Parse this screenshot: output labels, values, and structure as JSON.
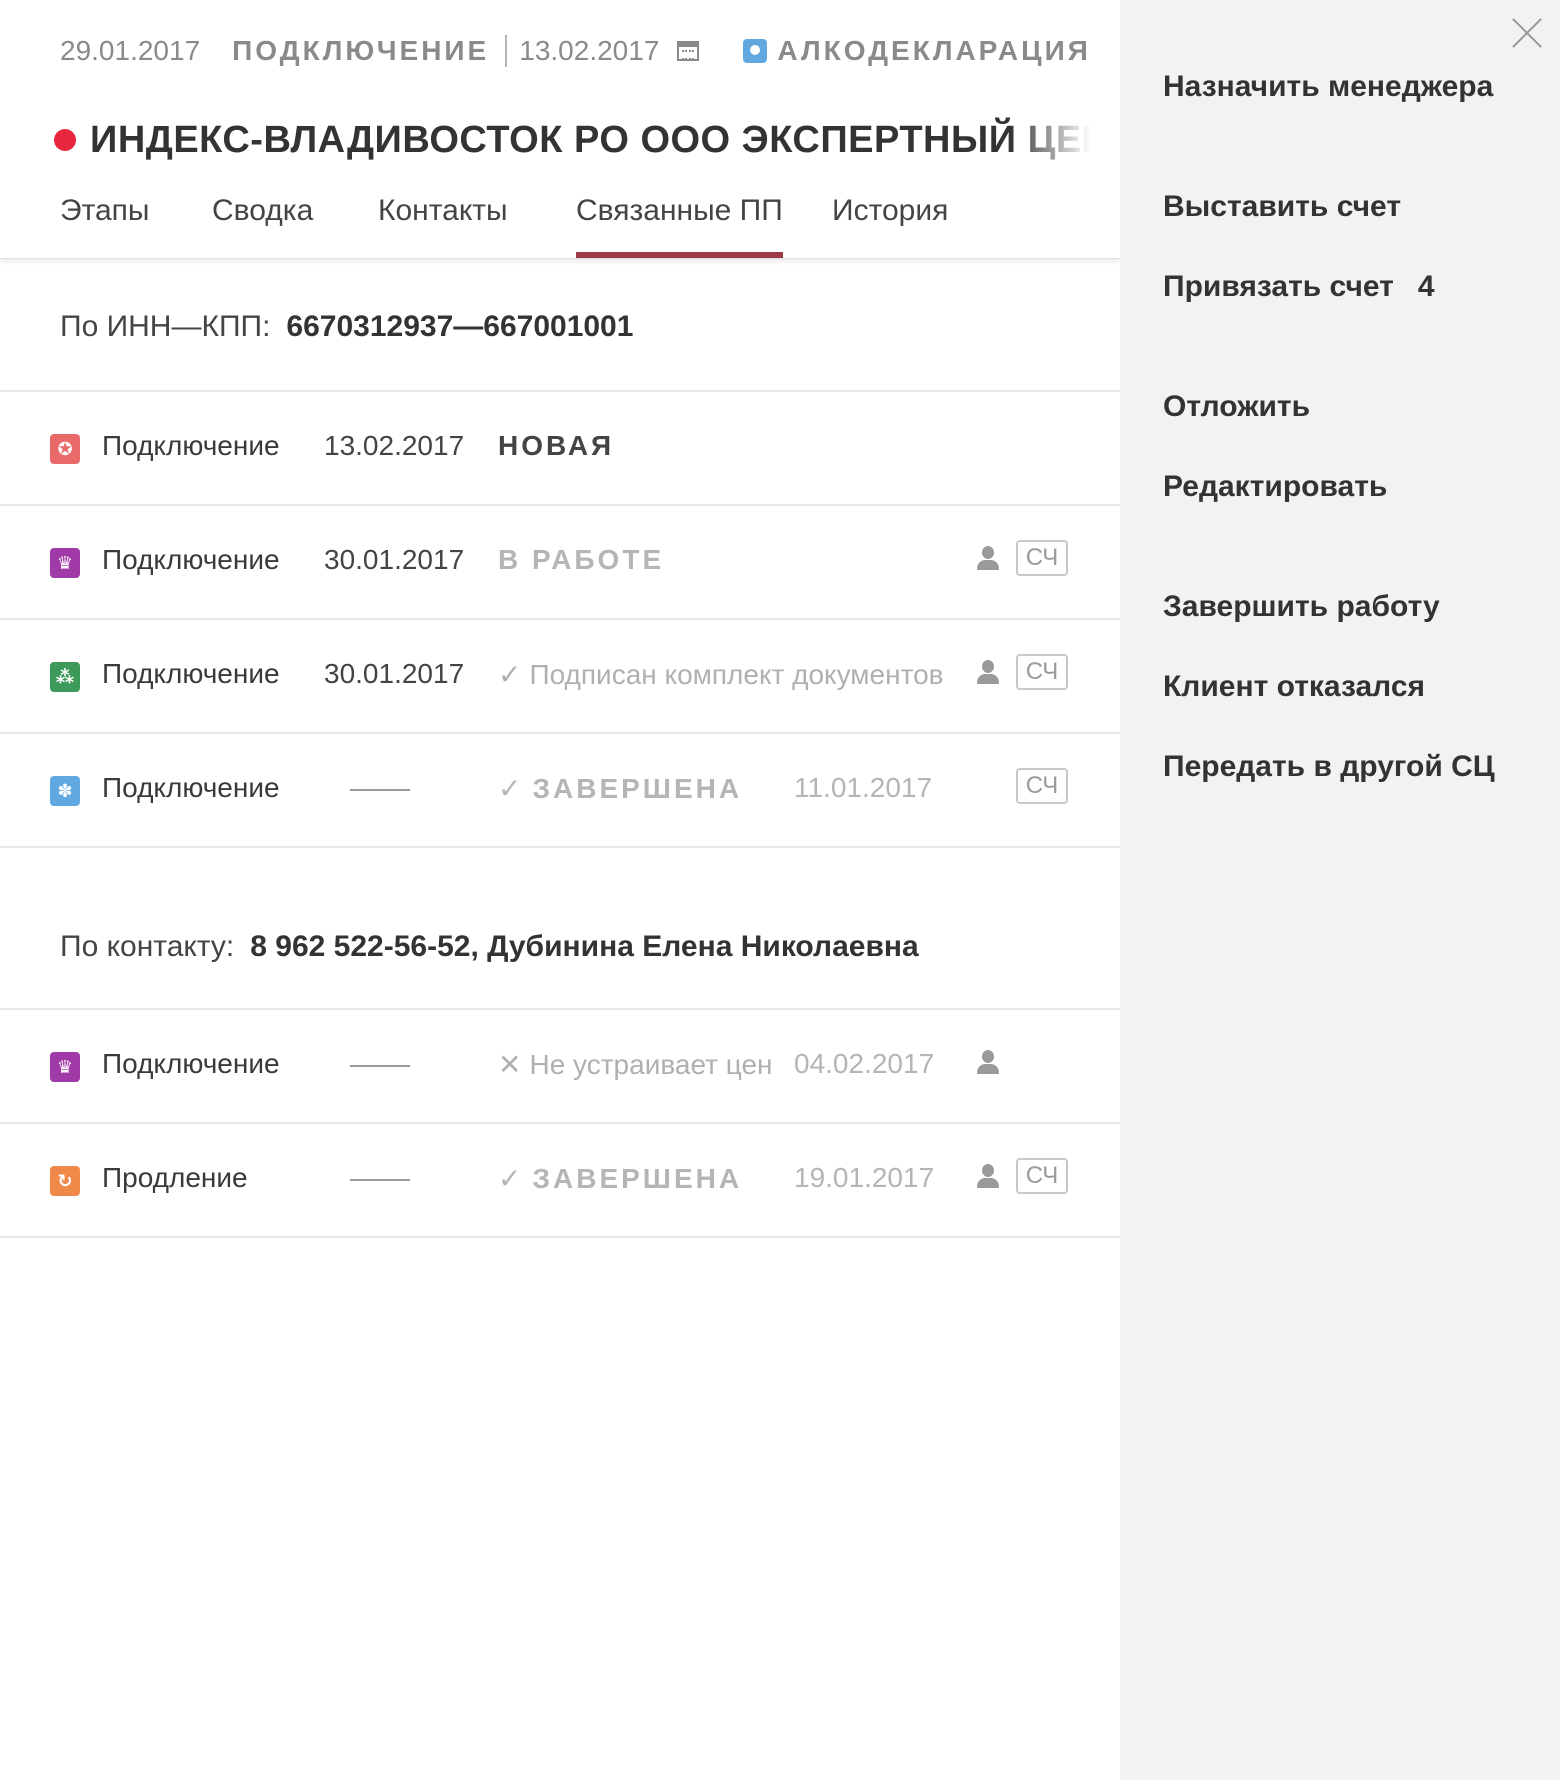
{
  "header": {
    "created_date": "29.01.2017",
    "type": "ПОДКЛЮЧЕНИЕ",
    "planned_date": "13.02.2017",
    "product": "АЛКОДЕКЛАРАЦИЯ",
    "title": "ИНДЕКС-ВЛАДИВОСТОК РО ООО ЭКСПЕРТНЫЙ ЦЕНТР ИН"
  },
  "tabs": [
    {
      "label": "Этапы",
      "active": false
    },
    {
      "label": "Сводка",
      "active": false
    },
    {
      "label": "Контакты",
      "active": false
    },
    {
      "label": "Связанные ПП",
      "active": true
    },
    {
      "label": "История",
      "active": false
    }
  ],
  "section_inn": {
    "label": "По ИНН—КПП:",
    "value": "6670312937—667001001",
    "rows": [
      {
        "icon": "certificate-icon",
        "color": "#ea6a6a",
        "type": "Подключение",
        "date": "13.02.2017",
        "status": "НОВАЯ",
        "status_style": "caps-dark",
        "status_mark": "",
        "date2": "",
        "has_person": false,
        "has_sch": false,
        "sch_label": ""
      },
      {
        "icon": "crown-icon",
        "color": "#a03aa6",
        "type": "Подключение",
        "date": "30.01.2017",
        "status": "В РАБОТЕ",
        "status_style": "caps-light",
        "status_mark": "",
        "date2": "",
        "has_person": true,
        "has_sch": true,
        "sch_label": "СЧ"
      },
      {
        "icon": "network-icon",
        "color": "#3d9a5a",
        "type": "Подключение",
        "date": "30.01.2017",
        "status": "Подписан комплект документов",
        "status_style": "text",
        "status_mark": "✓",
        "date2": "",
        "has_person": true,
        "has_sch": true,
        "sch_label": "СЧ"
      },
      {
        "icon": "grape-icon",
        "color": "#62a8e0",
        "type": "Подключение",
        "date": "",
        "status": "ЗАВЕРШЕНА",
        "status_style": "caps-light",
        "status_mark": "✓",
        "date2": "11.01.2017",
        "has_person": false,
        "has_sch": true,
        "sch_label": "СЧ"
      }
    ]
  },
  "section_contact": {
    "label": "По контакту:",
    "value": "8 962 522-56-52, Дубинина Елена Николаевна",
    "rows": [
      {
        "icon": "crown-icon",
        "color": "#a03aa6",
        "type": "Подключение",
        "date": "",
        "status": "Не устраивает цена",
        "status_style": "text",
        "status_mark": "✕",
        "date2": "04.02.2017",
        "has_person": true,
        "has_sch": false,
        "sch_label": ""
      },
      {
        "icon": "renew-icon",
        "color": "#f0884a",
        "type": "Продление",
        "date": "",
        "status": "ЗАВЕРШЕНА",
        "status_style": "caps-light",
        "status_mark": "✓",
        "date2": "19.01.2017",
        "has_person": true,
        "has_sch": true,
        "sch_label": "СЧ"
      }
    ]
  },
  "side_menu": {
    "items": [
      {
        "label": "Назначить менеджера",
        "count": ""
      },
      {
        "label": "Выставить счет",
        "count": ""
      },
      {
        "label": "Привязать счет",
        "count": "4"
      },
      {
        "label": "Отложить",
        "count": ""
      },
      {
        "label": "Редактировать",
        "count": ""
      },
      {
        "label": "Завершить работу",
        "count": ""
      },
      {
        "label": "Клиент отказался",
        "count": ""
      },
      {
        "label": "Передать в другой СЦ",
        "count": ""
      }
    ]
  }
}
